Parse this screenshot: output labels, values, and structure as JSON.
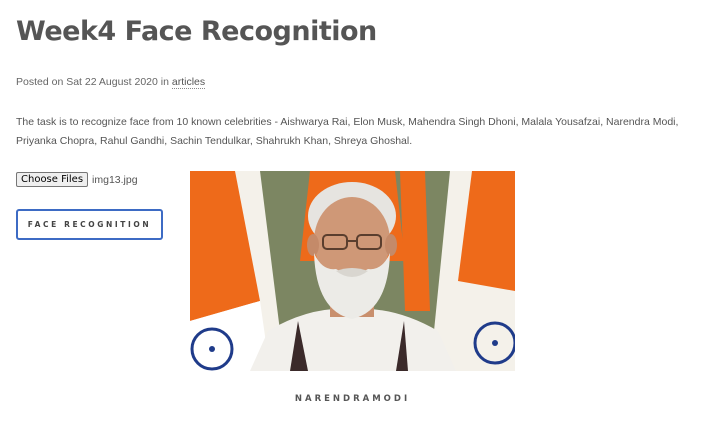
{
  "post": {
    "title": "Week4 Face Recognition",
    "meta_prefix": "Posted on Sat 22 August 2020 in ",
    "category": "articles",
    "description": "The task is to recognize face from 10 known celebrities - Aishwarya Rai, Elon Musk, Mahendra Singh Dhoni, Malala Yousafzai, Narendra Modi, Priyanka Chopra, Rahul Gandhi, Sachin Tendulkar, Shahrukh Khan, Shreya Ghoshal."
  },
  "upload": {
    "choose_label": "Choose Files",
    "file_name": "img13.jpg"
  },
  "actions": {
    "recognize_label": "FACE RECOGNITION"
  },
  "result": {
    "label": "NARENDRAMODI"
  },
  "colors": {
    "accent": "#3d6bc4",
    "text": "#555555",
    "flag_saffron": "#ee6a1a",
    "flag_chakra": "#1f3b8a"
  }
}
